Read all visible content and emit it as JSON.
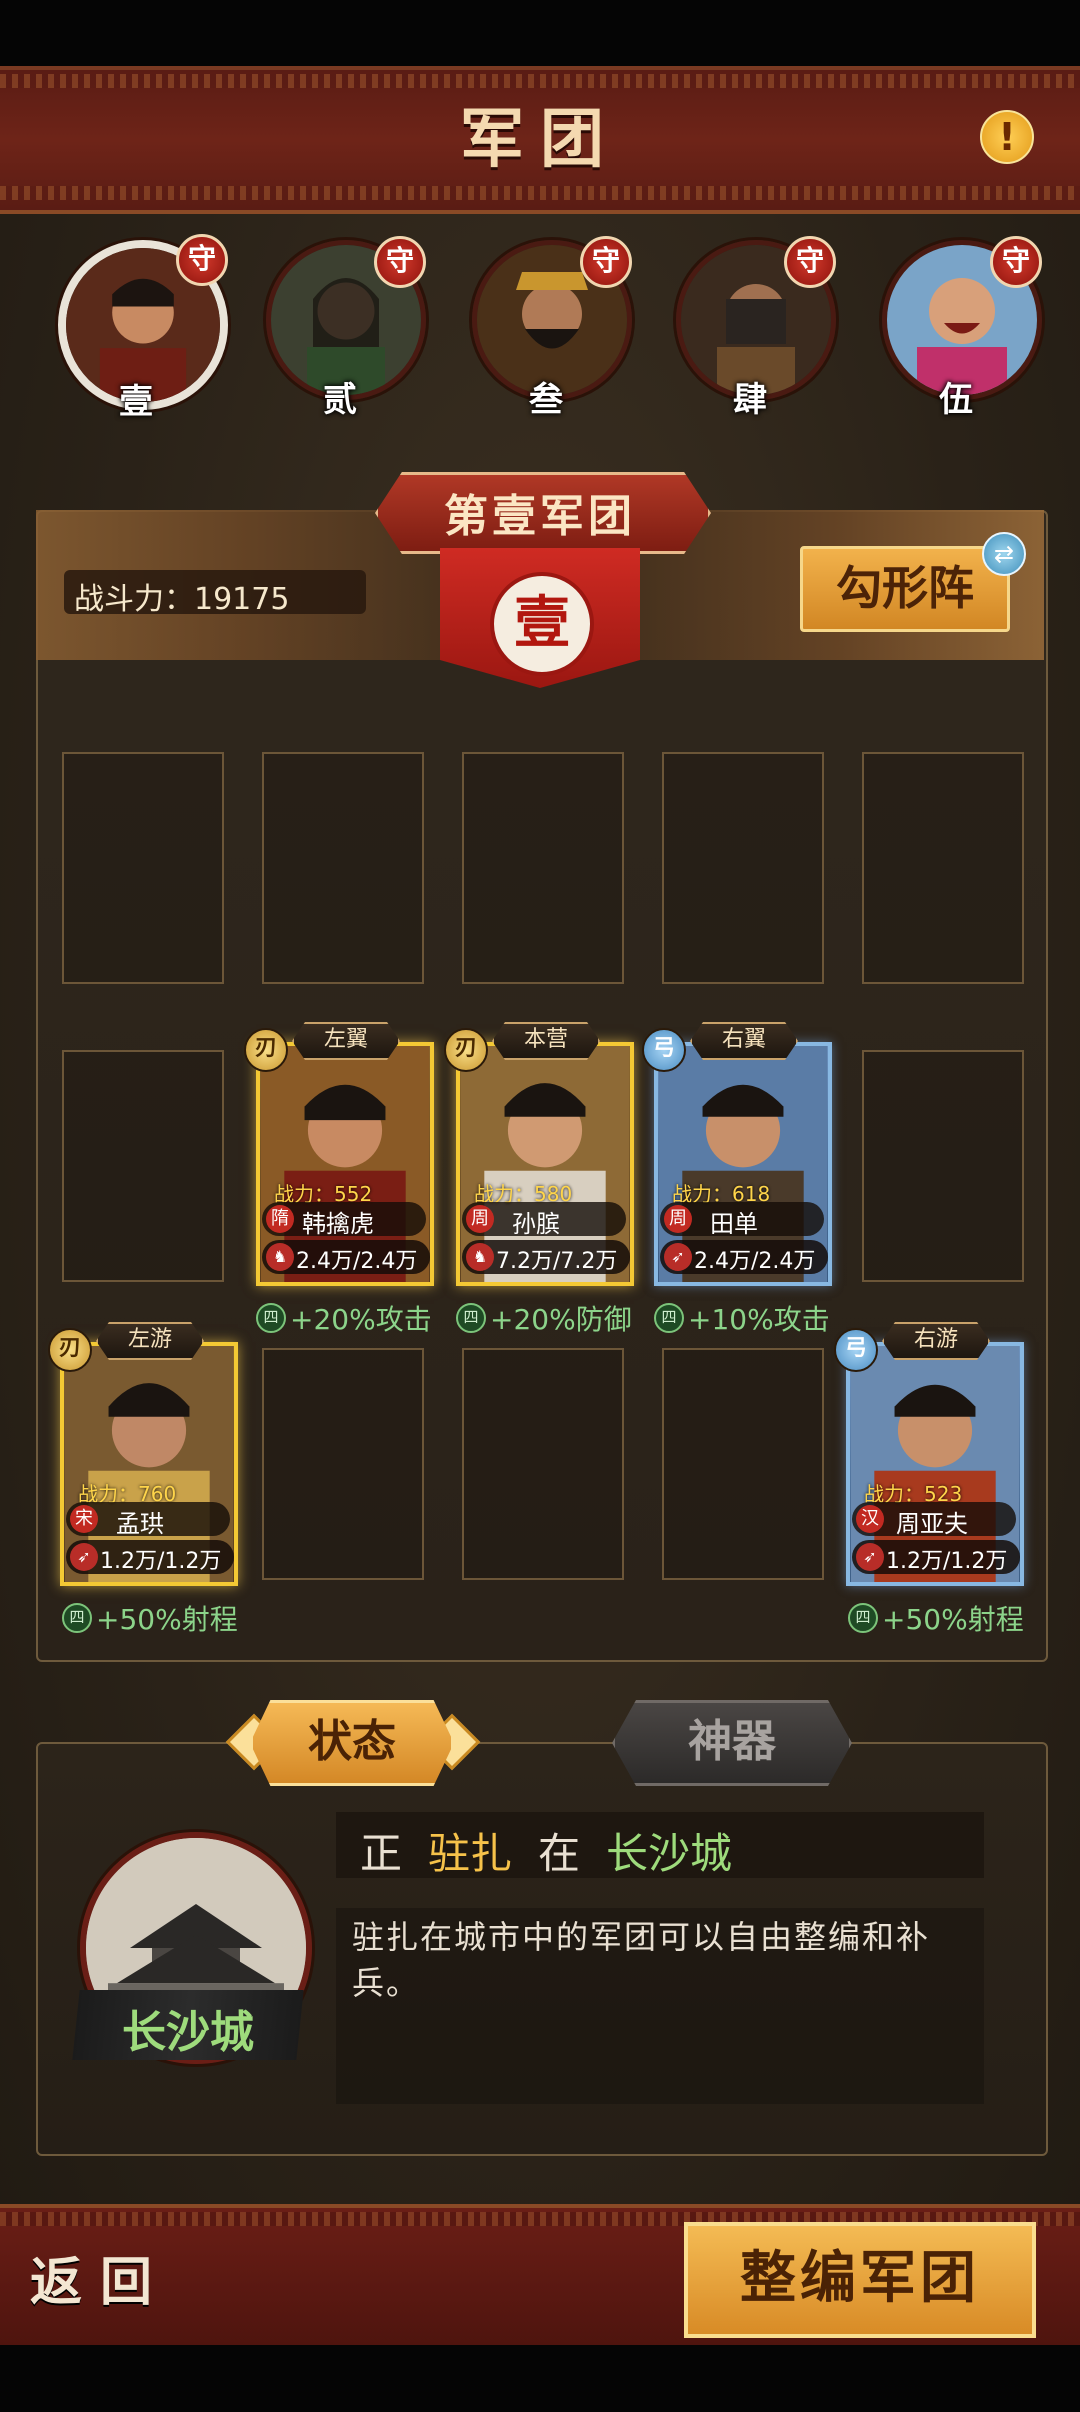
{
  "header": {
    "title": "军团",
    "info_icon": "!"
  },
  "legions": [
    {
      "shou": "守",
      "num": "壹",
      "selected": true
    },
    {
      "shou": "守",
      "num": "贰",
      "selected": false
    },
    {
      "shou": "守",
      "num": "叁",
      "selected": false
    },
    {
      "shou": "守",
      "num": "肆",
      "selected": false
    },
    {
      "shou": "守",
      "num": "伍",
      "selected": false
    }
  ],
  "legion_panel": {
    "title": "第壹军团",
    "seal": "壹",
    "power_label": "战斗力：19175",
    "formation_button": "勾形阵",
    "formation_swap_icon": "swap-icon"
  },
  "cards": [
    {
      "pos": "左翼",
      "type_badge": "刃",
      "power": "战力：552",
      "dynasty": "隋",
      "name": "韩擒虎",
      "troops": "2.4万/2.4万",
      "bonus": "+20%攻击",
      "bonus_badge": "四",
      "color": "gold"
    },
    {
      "pos": "本营",
      "type_badge": "刃",
      "power": "战力：580",
      "dynasty": "周",
      "name": "孙膑",
      "troops": "7.2万/7.2万",
      "bonus": "+20%防御",
      "bonus_badge": "四",
      "color": "gold"
    },
    {
      "pos": "右翼",
      "type_badge": "弓",
      "power": "战力：618",
      "dynasty": "周",
      "name": "田单",
      "troops": "2.4万/2.4万",
      "bonus": "+10%攻击",
      "bonus_badge": "四",
      "color": "blue"
    },
    {
      "pos": "左游",
      "type_badge": "刃",
      "power": "战力：760",
      "dynasty": "宋",
      "name": "孟珙",
      "troops": "1.2万/1.2万",
      "bonus": "+50%射程",
      "bonus_badge": "四",
      "color": "gold"
    },
    {
      "pos": "右游",
      "type_badge": "弓",
      "power": "战力：523",
      "dynasty": "汉",
      "name": "周亚夫",
      "troops": "1.2万/1.2万",
      "bonus": "+50%射程",
      "bonus_badge": "四",
      "color": "blue"
    }
  ],
  "tabs": {
    "status": "状态",
    "artifact": "神器"
  },
  "status": {
    "prefix": "正",
    "action": "驻扎",
    "in": "在",
    "city": "长沙城",
    "description": "驻扎在城市中的军团可以自由整编和补兵。",
    "city_label": "长沙城"
  },
  "footer": {
    "back": "返回",
    "reorganize": "整编军团"
  },
  "colors": {
    "accent_gold": "#f2b24c",
    "header_red": "#6e2418",
    "bonus_green": "#8cd48a",
    "city_green": "#9edb7c"
  }
}
